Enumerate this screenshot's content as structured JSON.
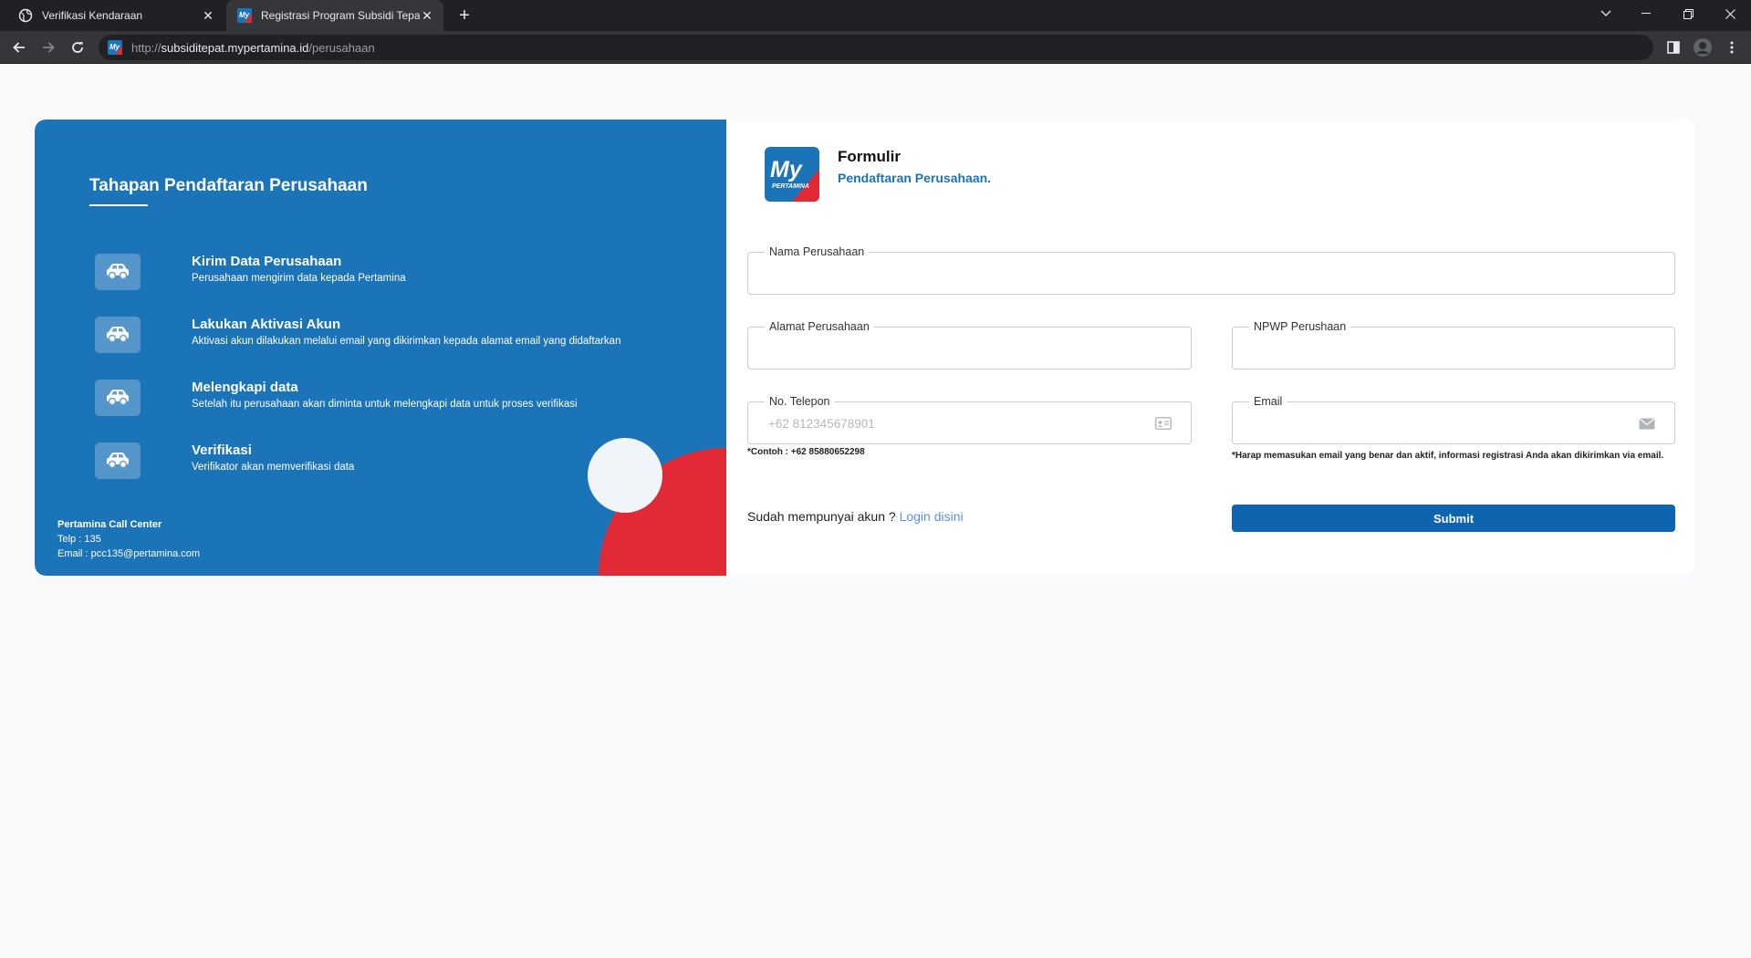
{
  "browser": {
    "tabs": [
      {
        "title": "Verifikasi Kendaraan",
        "active": false
      },
      {
        "title": "Registrasi Program Subsidi Tepat",
        "active": true
      }
    ],
    "url_scheme": "http://",
    "url_host": "subsiditepat.mypertamina.id",
    "url_path": "/perusahaan"
  },
  "left_panel": {
    "title": "Tahapan Pendaftaran Perusahaan",
    "steps": [
      {
        "title": "Kirim Data Perusahaan",
        "desc": "Perusahaan mengirim data kepada Pertamina",
        "icon": "car-icon"
      },
      {
        "title": "Lakukan Aktivasi Akun",
        "desc": "Aktivasi akun dilakukan melalui email yang dikirimkan kepada alamat email yang didaftarkan",
        "icon": "car-icon"
      },
      {
        "title": "Melengkapi data",
        "desc": "Setelah itu perusahaan akan diminta untuk melengkapi data untuk proses verifikasi",
        "icon": "car-icon"
      },
      {
        "title": "Verifikasi",
        "desc": "Verifikator akan memverifikasi data",
        "icon": "car-icon"
      }
    ],
    "call_center": {
      "title": "Pertamina Call Center",
      "telp": "Telp : 135",
      "email": "Email : pcc135@pertamina.com"
    }
  },
  "form": {
    "logo_text": "My",
    "logo_subtext": "PERTAMINA",
    "title": "Formulir",
    "subtitle": "Pendaftaran Perusahaan.",
    "fields": {
      "nama": {
        "label": "Nama Perusahaan",
        "value": "",
        "placeholder": ""
      },
      "alamat": {
        "label": "Alamat Perusahaan",
        "value": "",
        "placeholder": ""
      },
      "npwp": {
        "label": "NPWP Perushaan",
        "value": "",
        "placeholder": ""
      },
      "telepon": {
        "label": "No. Telepon",
        "value": "",
        "placeholder": "+62 812345678901",
        "icon": "id-card-icon"
      },
      "email": {
        "label": "Email",
        "value": "",
        "placeholder": "",
        "icon": "envelope-icon"
      }
    },
    "phone_hint": "*Contoh : +62 85880652298",
    "email_hint": "*Harap memasukan email yang benar dan aktif, informasi registrasi Anda akan dikirimkan via email.",
    "login_prompt": "Sudah mempunyai akun ? ",
    "login_link": "Login disini",
    "submit_label": "Submit"
  },
  "colors": {
    "primary_blue": "#1b73b8",
    "button_blue": "#0f64b0",
    "accent_red": "#e22a36",
    "link_blue": "#5b8fe0"
  }
}
